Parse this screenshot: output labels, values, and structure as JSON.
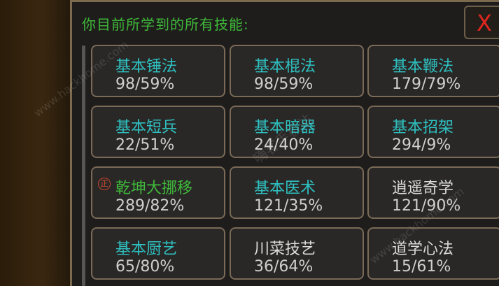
{
  "panel": {
    "title": "你目前所学到的所有技能:",
    "close_label": "X"
  },
  "skills": [
    {
      "name": "基本锤法",
      "progress": "98/59%",
      "color": "#2fc0c0"
    },
    {
      "name": "基本棍法",
      "progress": "98/59%",
      "color": "#2fc0c0"
    },
    {
      "name": "基本鞭法",
      "progress": "179/79%",
      "color": "#2fc0c0"
    },
    {
      "name": "基本短兵",
      "progress": "22/51%",
      "color": "#2fc0c0"
    },
    {
      "name": "基本暗器",
      "progress": "24/40%",
      "color": "#2fc0c0"
    },
    {
      "name": "基本招架",
      "progress": "294/9%",
      "color": "#2fc0c0"
    },
    {
      "name": "乾坤大挪移",
      "progress": "289/82%",
      "color": "#3fb93a",
      "badge": "正"
    },
    {
      "name": "基本医术",
      "progress": "121/35%",
      "color": "#2fc0c0"
    },
    {
      "name": "逍遥奇学",
      "progress": "121/90%",
      "color": "#dcdcdc"
    },
    {
      "name": "基本厨艺",
      "progress": "65/80%",
      "color": "#2fc0c0"
    },
    {
      "name": "川菜技艺",
      "progress": "36/64%",
      "color": "#dcdcdc"
    },
    {
      "name": "道学心法",
      "progress": "15/61%",
      "color": "#dcdcdc"
    }
  ],
  "watermarks": [
    "www.hackhome.com",
    "嗨客手机站",
    "www.hackhome.com"
  ]
}
